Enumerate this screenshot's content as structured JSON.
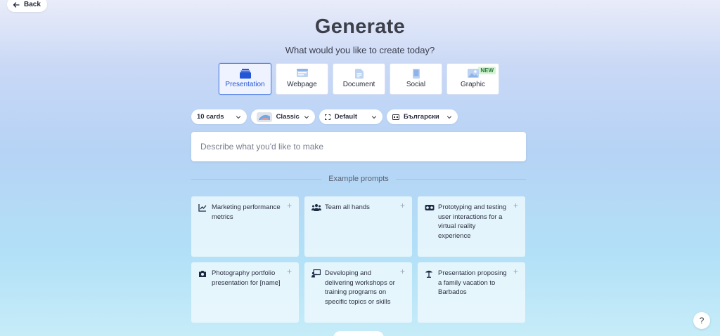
{
  "back": {
    "label": "Back"
  },
  "header": {
    "title": "Generate",
    "subtitle": "What would you like to create today?"
  },
  "types": [
    {
      "label": "Presentation",
      "icon": "presentation-icon",
      "active": true
    },
    {
      "label": "Webpage",
      "icon": "webpage-icon"
    },
    {
      "label": "Document",
      "icon": "document-icon"
    },
    {
      "label": "Social",
      "icon": "social-icon"
    },
    {
      "label": "Graphic",
      "icon": "graphic-icon",
      "badge": "NEW"
    }
  ],
  "options": {
    "cards": "10 cards",
    "theme": "Classic",
    "size": "Default",
    "language": "Български"
  },
  "prompt": {
    "placeholder": "Describe what you'd like to make"
  },
  "examples": {
    "heading": "Example prompts",
    "items": [
      {
        "text": "Marketing performance metrics",
        "icon": "chart-icon"
      },
      {
        "text": "Team all hands",
        "icon": "people-icon"
      },
      {
        "text": "Prototyping and testing user interactions for a virtual reality experience",
        "icon": "vr-headset-icon"
      },
      {
        "text": "Photography portfolio presentation for [name]",
        "icon": "camera-icon"
      },
      {
        "text": "Developing and delivering workshops or training programs on specific topics or skills",
        "icon": "presenter-icon"
      },
      {
        "text": "Presentation proposing a family vacation to Barbados",
        "icon": "beach-umbrella-icon"
      }
    ]
  },
  "help": {
    "label": "?"
  },
  "colors": {
    "accent": "#2455d6",
    "active_border": "#5a86e6",
    "new_badge": "#d4f4d6"
  }
}
